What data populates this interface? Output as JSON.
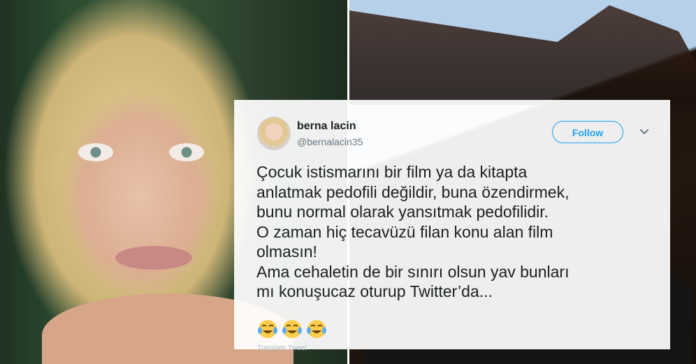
{
  "tweet": {
    "display_name": "berna lacin",
    "handle": "@bernalacin35",
    "follow_label": "Follow",
    "text_lines": [
      "Çocuk istismarını bir film ya da kitapta",
      "anlatmak pedofili değildir, buna özendirmek,",
      "bunu normal olarak yansıtmak pedofilidir.",
      "O zaman hiç tecavüzü filan konu alan film",
      "olmasın!",
      "Ama cehaletin de bir sınırı olsun yav bunları",
      "mı konuşucaz oturup Twitter’da..."
    ],
    "emojis": [
      "face-with-tears-of-joy-icon",
      "face-with-tears-of-joy-icon",
      "face-with-tears-of-joy-icon"
    ],
    "meta_partial": "Translate Tweet"
  },
  "colors": {
    "twitter_blue": "#1da1f2",
    "text_primary": "#1c2022",
    "text_secondary": "#697882"
  }
}
